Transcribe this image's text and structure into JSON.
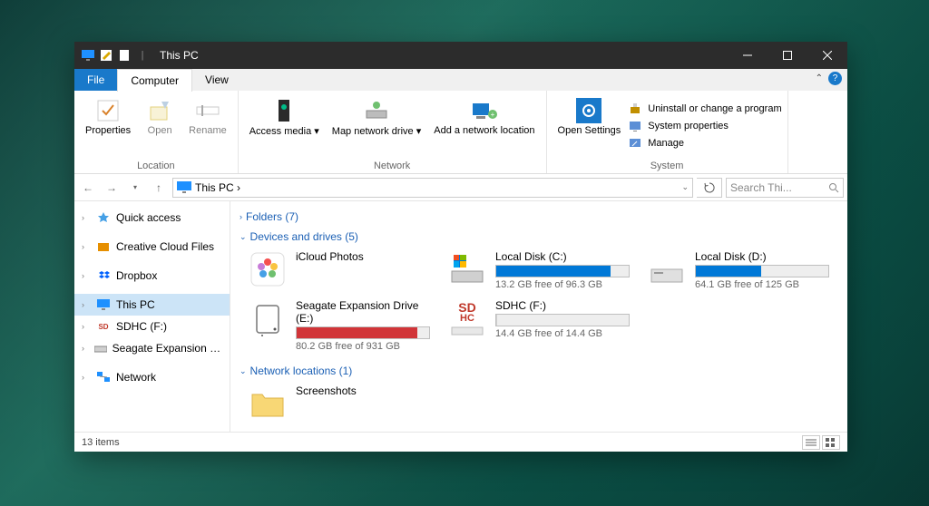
{
  "title": "This PC",
  "menutabs": {
    "file": "File",
    "computer": "Computer",
    "view": "View"
  },
  "ribbon": {
    "location": {
      "label": "Location",
      "properties": "Properties",
      "open": "Open",
      "rename": "Rename"
    },
    "network": {
      "label": "Network",
      "access_media": "Access media ▾",
      "map_drive": "Map network drive ▾",
      "add_location": "Add a network location"
    },
    "system": {
      "label": "System",
      "open_settings": "Open Settings",
      "uninstall": "Uninstall or change a program",
      "properties": "System properties",
      "manage": "Manage"
    }
  },
  "nav": {
    "path": "This PC ›",
    "search_placeholder": "Search Thi..."
  },
  "sidebar": [
    {
      "name": "Quick access",
      "id": "quick-access"
    },
    {
      "name": "Creative Cloud Files",
      "id": "creative-cloud"
    },
    {
      "name": "Dropbox",
      "id": "dropbox"
    },
    {
      "name": "This PC",
      "id": "this-pc",
      "active": true
    },
    {
      "name": "SDHC (F:)",
      "id": "sdhc"
    },
    {
      "name": "Seagate Expansion Drive (E:)",
      "id": "seagate"
    },
    {
      "name": "Network",
      "id": "network"
    }
  ],
  "sections": {
    "folders": "Folders (7)",
    "devices": "Devices and drives (5)",
    "netloc": "Network locations (1)"
  },
  "drives": {
    "icloud": {
      "name": "iCloud Photos"
    },
    "c": {
      "name": "Local Disk (C:)",
      "free": "13.2 GB free of 96.3 GB",
      "fill": 86,
      "color": "#0078d7"
    },
    "d": {
      "name": "Local Disk (D:)",
      "free": "64.1 GB free of 125 GB",
      "fill": 49,
      "color": "#0078d7"
    },
    "e": {
      "name": "Seagate Expansion Drive (E:)",
      "free": "80.2 GB free of 931 GB",
      "fill": 91,
      "color": "#d13438"
    },
    "f": {
      "name": "SDHC (F:)",
      "free": "14.4 GB free of 14.4 GB",
      "fill": 1,
      "color": "#cfcfcf"
    }
  },
  "netlocations": {
    "screenshots": "Screenshots"
  },
  "status": {
    "items": "13 items"
  }
}
